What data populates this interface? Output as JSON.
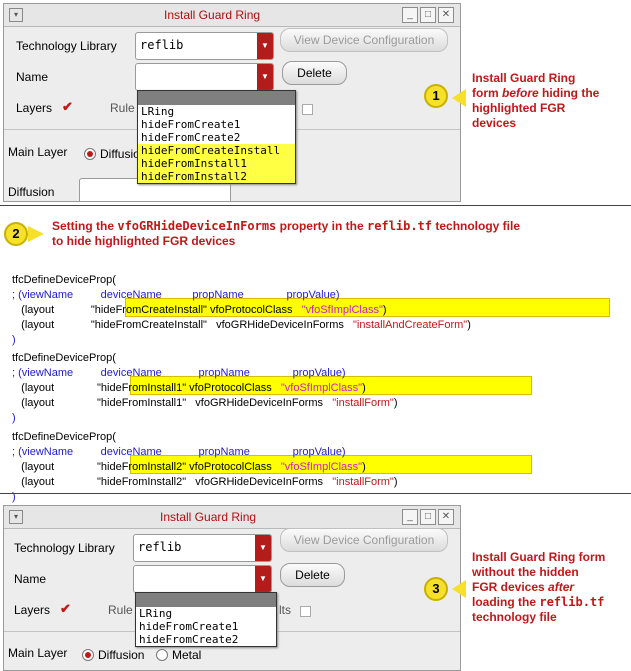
{
  "top_form": {
    "title": "Install Guard Ring",
    "tech_lib_label": "Technology Library",
    "tech_lib_value": "reflib",
    "view_device_config": "View Device Configuration",
    "name_label": "Name",
    "delete_label": "Delete",
    "layers_label": "Layers",
    "rules_label": "Rule",
    "main_layer_label": "Main Layer",
    "diffusion_radio": "Diffusio",
    "diffusion_label": "Diffusion",
    "dropdown_items": [
      "LRing",
      "hideFromCreate1",
      "hideFromCreate2",
      "hideFromCreateInstall",
      "hideFromInstall1",
      "hideFromInstall2"
    ],
    "highlighted_items": [
      "hideFromCreateInstall",
      "hideFromInstall1",
      "hideFromInstall2"
    ]
  },
  "callout1": {
    "number": "1",
    "line1": "Install Guard Ring",
    "line2a": "form ",
    "line2b": "before",
    "line2c": " hiding the",
    "line3": "highlighted FGR",
    "line4": "devices"
  },
  "callout2": {
    "number": "2",
    "t1": "Setting the ",
    "t2": "vfoGRHideDeviceInForms",
    "t3": " property in the ",
    "t4": "reflib.tf",
    "t5": " technology file",
    "line2": "to hide highlighted FGR devices"
  },
  "code": {
    "block1": {
      "fn": "tfcDefineDeviceProp(",
      "hdr_semi": ";",
      "hdr": "(viewName         deviceName          propName              propValue)",
      "row1_a": "(layout",
      "row1_b": "\"hideFromCreateInstall\"",
      "row1_c": " vfoProtocolClass",
      "row1_d": "\"vfoSfImplClass\"",
      "row1_e": ")",
      "row2_a": "(layout",
      "row2_b": "\"hideFromCreateInstall\"",
      "row2_c": "vfoGRHideDeviceInForms",
      "row2_d": "\"installAndCreateForm\"",
      "row2_e": ")",
      "close": ")"
    },
    "block2": {
      "fn": "tfcDefineDeviceProp(",
      "hdr_semi": ";",
      "hdr": "(viewName         deviceName            propName              propValue)",
      "row1_a": "(layout",
      "row1_b": "\"hideFromInstall1\"",
      "row1_c": " vfoProtocolClass",
      "row1_d": "\"vfoSfImplClass\"",
      "row1_e": ")",
      "row2_a": "(layout",
      "row2_b": "\"hideFromInstall1\"",
      "row2_c": "vfoGRHideDeviceInForms",
      "row2_d": "\"installForm\"",
      "row2_e": ")",
      "close": ")"
    },
    "block3": {
      "fn": "tfcDefineDeviceProp(",
      "hdr_semi": ";",
      "hdr": "(viewName         deviceName            propName              propValue)",
      "row1_a": "(layout",
      "row1_b": "\"hideFromInstall2\"",
      "row1_c": " vfoProtocolClass",
      "row1_d": "\"vfoSfImplClass\"",
      "row1_e": ")",
      "row2_a": "(layout",
      "row2_b": "\"hideFromInstall2\"",
      "row2_c": "vfoGRHideDeviceInForms",
      "row2_d": "\"installForm\"",
      "row2_e": ")",
      "close": ")"
    }
  },
  "bottom_form": {
    "title": "Install Guard Ring",
    "tech_lib_label": "Technology Library",
    "tech_lib_value": "reflib",
    "view_device_config": "View Device Configuration",
    "name_label": "Name",
    "delete_label": "Delete",
    "layers_label": "Layers",
    "rules_label": "Rule",
    "results_label": "lts",
    "main_layer_label": "Main Layer",
    "diffusion_label": "Diffusion",
    "metal_label": "Metal",
    "dropdown_items": [
      "LRing",
      "hideFromCreate1",
      "hideFromCreate2"
    ]
  },
  "callout3": {
    "number": "3",
    "line1": "Install Guard Ring form",
    "line2": "without the hidden",
    "line3a": "FGR devices ",
    "line3b": "after",
    "line4": "loading the ",
    "line4b": "reflib.tf",
    "line5": "technology file"
  },
  "colors": {
    "accent_red": "#c01818",
    "highlight": "#ffff00",
    "code_blue": "#1d1dc8",
    "code_magenta": "#d01ad0",
    "callout_yellow": "#f6e02a"
  }
}
